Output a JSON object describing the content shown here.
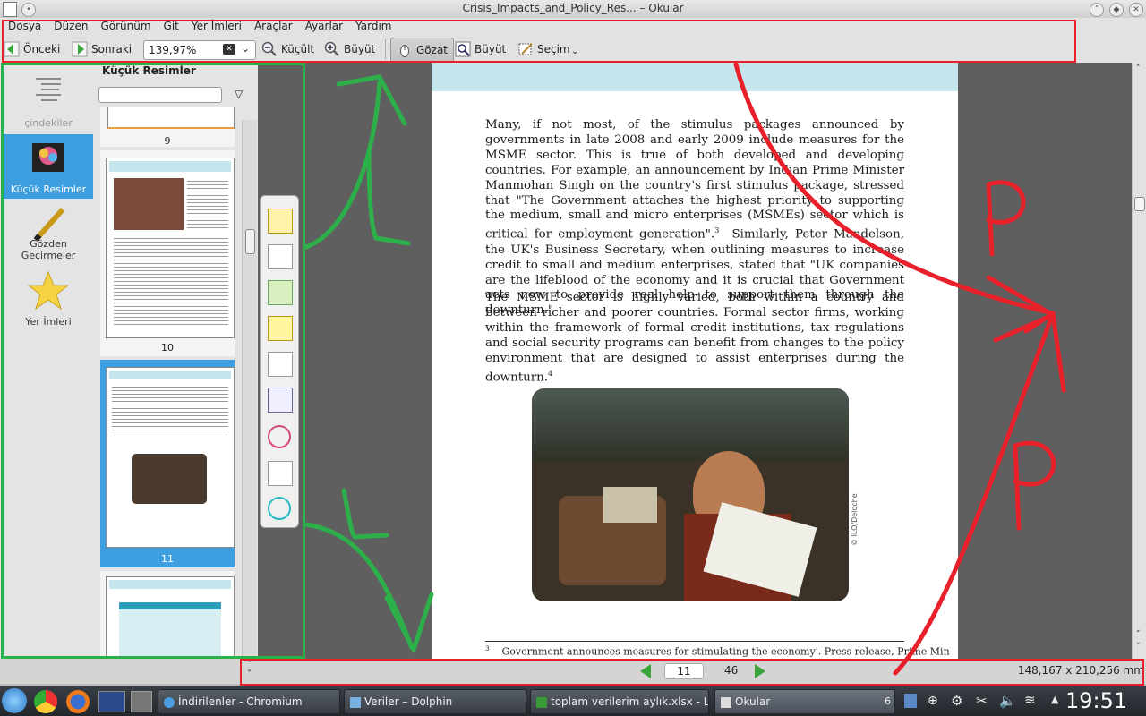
{
  "window": {
    "title": "Crisis_Impacts_and_Policy_Res... – Okular"
  },
  "menu": [
    "Dosya",
    "Düzen",
    "Görünüm",
    "Git",
    "Yer İmleri",
    "Araçlar",
    "Ayarlar",
    "Yardım"
  ],
  "toolbar": {
    "prev": "Önceki",
    "next": "Sonraki",
    "zoom_value": "139,97%",
    "zoom_out": "Küçült",
    "zoom_in": "Büyüt",
    "browse": "Gözat",
    "zoom_tool": "Büyüt",
    "selection": "Seçim"
  },
  "sidebar": {
    "items": [
      {
        "label": "çindekiler",
        "icon": "contents-icon"
      },
      {
        "label": "Küçük Resimler",
        "icon": "thumbnails-icon"
      },
      {
        "label": "Gözden Geçirmeler",
        "icon": "pencil-icon"
      },
      {
        "label": "Yer İmleri",
        "icon": "star-icon"
      }
    ],
    "active_index": 1
  },
  "thumbnails": {
    "title": "Küçük Resimler",
    "pages": [
      "9",
      "10",
      "11"
    ],
    "selected": "11"
  },
  "document": {
    "paragraph1": "Many, if not most, of the stimulus packages announced by governments in late 2008 and early 2009 include measures for the MSME sector.  This is true of both developed and developing countries. For example, an announcement by Indian Prime Minister Manmohan Singh on the country's first stimulus package, stressed that \"The Government attaches the highest priority to supporting the medium, small and micro enterprises (MSMEs) sector which is critical for employment generation\".",
    "footnote_ref1": "3",
    "paragraph1b": "Similarly, Peter Mandelson, the UK's Business Secretary, when outlining measures to increase credit to small and medium enterprises, stated that \"UK companies are the lifeblood of the economy and it is crucial that Government acts now to provide real help to support them through the downturn.\"",
    "paragraph2": "The MSME sector is highly varied, both within a country and between richer and poorer countries.  Formal sector firms, working within the framework of formal credit institutions, tax regulations and social security programs can benefit from changes to the policy environment that are designed to assist enterprises during the downturn.",
    "footnote_ref2": "4",
    "photo_credit": "© ILO/Deloche",
    "footnote_num": "3",
    "footnote_text": "Government announces measures for stimulating the economy'. Press release, Prime Min-"
  },
  "status": {
    "current_page": "11",
    "total_pages": "46",
    "page_size": "148,167 x 210,256 mm"
  },
  "taskbar": {
    "tasks": [
      "İndirilenler - Chromium",
      "Veriler – Dolphin",
      "toplam verilerim aylık.xlsx - Libr",
      "Okular"
    ],
    "task_count": "6",
    "clock": "19:51"
  },
  "colors": {
    "annotation_red": "#e8202a",
    "annotation_green": "#2db04a",
    "selection_blue": "#3d9fe0"
  }
}
